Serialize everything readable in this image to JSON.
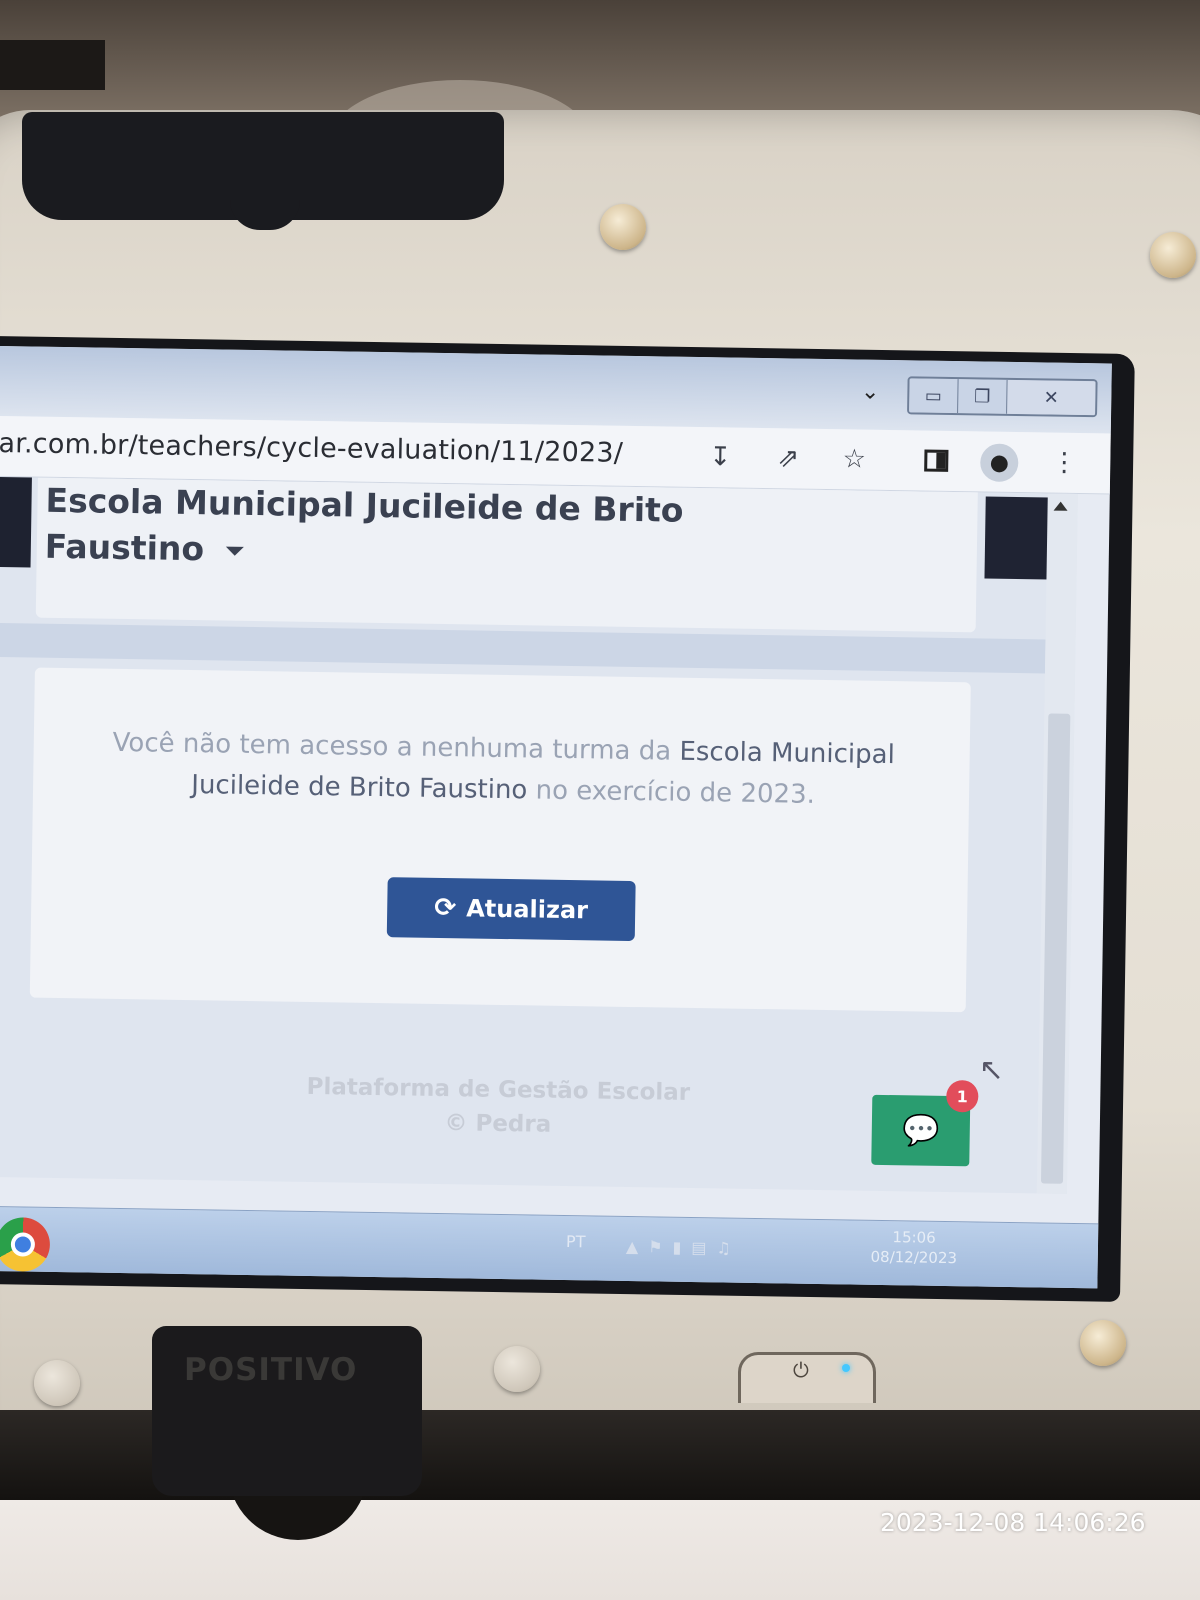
{
  "browser": {
    "url": "ar.com.br/teachers/cycle-evaluation/11/2023/",
    "toolbar_icons": [
      "install-icon",
      "share-icon",
      "star-icon",
      "side-panel-icon",
      "profile-icon",
      "menu-icon"
    ],
    "window_buttons": [
      "minimize-icon",
      "restore-icon",
      "close-icon"
    ]
  },
  "page": {
    "school_name": "Escola Municipal Jucileide de Brito Faustino",
    "message": {
      "prefix": "Você não tem acesso a nenhuma turma da",
      "school": "Escola Municipal Jucileide de Brito Faustino",
      "middle": "no exercício de",
      "year": "2023."
    },
    "refresh_button": "Atualizar",
    "footer_line1": "Plataforma de Gestão Escolar",
    "footer_line2": "© Pedra",
    "chat_badge": "1"
  },
  "taskbar": {
    "language": "PT",
    "time": "15:06",
    "date": "08/12/2023"
  },
  "device": {
    "brand": "POSITIVO"
  },
  "photo_timestamp": "2023-12-08  14:06:26",
  "colors": {
    "primary_button": "#2f5596",
    "chat_button": "#2a9d70",
    "badge": "#e24d5b"
  }
}
